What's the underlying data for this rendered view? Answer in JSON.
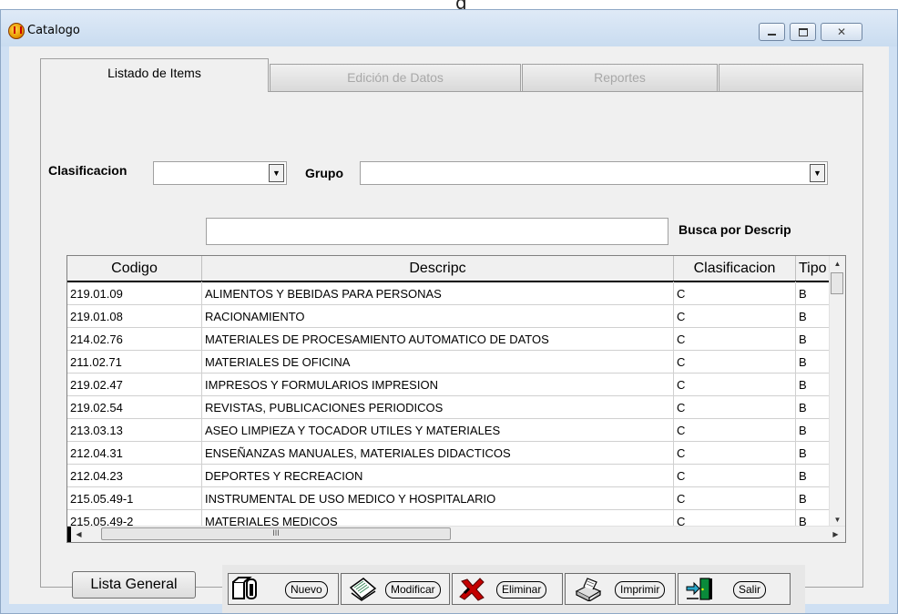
{
  "window": {
    "title": "Catalogo",
    "top_fragment": "g",
    "controls": {
      "minimize": "",
      "maximize": "",
      "close": "✕"
    }
  },
  "tabs": [
    {
      "label": "Listado de Items",
      "active": true
    },
    {
      "label": "Edición de Datos",
      "active": false
    },
    {
      "label": "Reportes",
      "active": false
    },
    {
      "label": "",
      "active": false
    }
  ],
  "filters": {
    "clasificacion_label": "Clasificacion",
    "clasificacion_value": "",
    "grupo_label": "Grupo",
    "grupo_value": "",
    "search_value": "",
    "search_label": "Busca por Descrip"
  },
  "grid": {
    "columns": [
      "Codigo",
      "Descripc",
      "Clasificacion",
      "Tipo"
    ],
    "rows": [
      [
        "219.01.09",
        "ALIMENTOS Y BEBIDAS PARA PERSONAS",
        "C",
        "B"
      ],
      [
        "219.01.08",
        "RACIONAMIENTO",
        "C",
        "B"
      ],
      [
        "214.02.76",
        "MATERIALES DE PROCESAMIENTO AUTOMATICO DE DATOS",
        "C",
        "B"
      ],
      [
        "211.02.71",
        "MATERIALES DE OFICINA",
        "C",
        "B"
      ],
      [
        "219.02.47",
        "IMPRESOS Y FORMULARIOS  IMPRESION",
        "C",
        "B"
      ],
      [
        "219.02.54",
        "REVISTAS, PUBLICACIONES PERIODICOS",
        "C",
        "B"
      ],
      [
        "213.03.13",
        "ASEO LIMPIEZA Y TOCADOR UTILES Y MATERIALES",
        "C",
        "B"
      ],
      [
        "212.04.31",
        "ENSEÑANZAS MANUALES, MATERIALES DIDACTICOS",
        "C",
        "B"
      ],
      [
        "212.04.23",
        "DEPORTES Y RECREACION",
        "C",
        "B"
      ],
      [
        "215.05.49-1",
        "INSTRUMENTAL DE USO MEDICO Y HOSPITALARIO",
        "C",
        "B"
      ],
      [
        "215.05.49-2",
        "MATERIALES MEDICOS",
        "C",
        "B"
      ]
    ],
    "hscroll_grip": "III"
  },
  "buttons": {
    "lista_general": "Lista General",
    "nuevo": "Nuevo",
    "modificar": "Modificar",
    "eliminar": "Eliminar",
    "imprimir": "Imprimir",
    "salir": "Salir"
  },
  "colors": {
    "window_frame": "#cfe0f3",
    "client_bg": "#f0f0f0",
    "accent_green": "#0a8a3a",
    "accent_red": "#c40000"
  }
}
